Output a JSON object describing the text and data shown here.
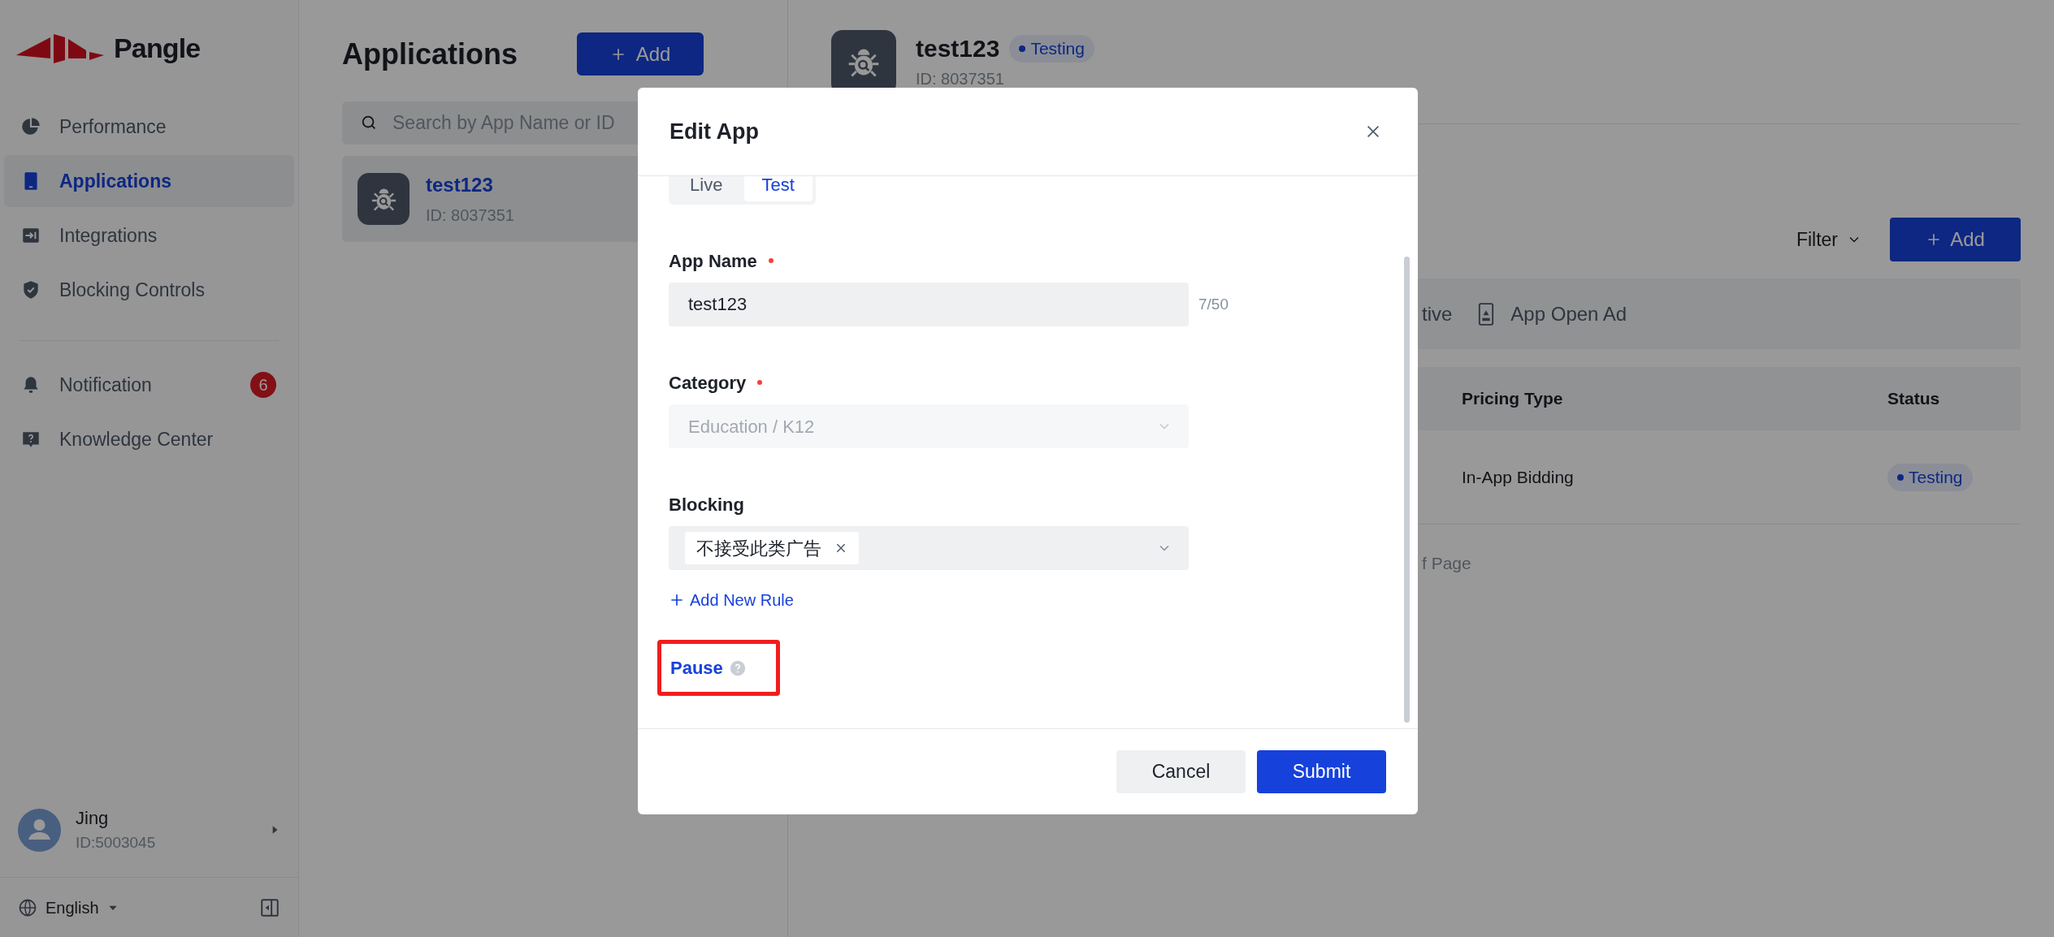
{
  "sidebar": {
    "logo": "Pangle",
    "items": [
      {
        "label": "Performance",
        "selected": false
      },
      {
        "label": "Applications",
        "selected": true
      },
      {
        "label": "Integrations",
        "selected": false
      },
      {
        "label": "Blocking Controls",
        "selected": false
      }
    ],
    "secondary_items": [
      {
        "label": "Notification",
        "badge": "6"
      },
      {
        "label": "Knowledge Center"
      }
    ],
    "user": {
      "name": "Jing",
      "id": "ID:5003045"
    },
    "language": "English"
  },
  "applications_panel": {
    "title": "Applications",
    "add_button": "Add",
    "search": {
      "placeholder": "Search by App Name or ID"
    },
    "apps": [
      {
        "name": "test123",
        "id": "ID: 8037351",
        "selected": true
      }
    ]
  },
  "app_detail": {
    "name": "test123",
    "status": "Testing",
    "id": "ID: 8037351",
    "filter": "Filter",
    "add_button": "Add",
    "ad_formats": [
      {
        "label": "tive",
        "kind": "text"
      },
      {
        "label": "App Open Ad",
        "kind": "app_open"
      }
    ],
    "table": {
      "columns": [
        "Pricing Type",
        "Status"
      ],
      "rows": [
        {
          "pricing_type": "In-App Bidding",
          "status": "Testing"
        }
      ]
    },
    "footer_fragment": "f Page"
  },
  "modal": {
    "title": "Edit App",
    "environment": [
      {
        "label": "Live",
        "selected": false
      },
      {
        "label": "Test",
        "selected": true
      }
    ],
    "fields": [
      {
        "kind": "text",
        "label": "App Name",
        "required": true,
        "disabled": false,
        "value": "test123",
        "counter": "7/50"
      },
      {
        "kind": "select",
        "label": "Category",
        "required": true,
        "disabled": true,
        "value": "Education / K12"
      },
      {
        "kind": "tags",
        "label": "Blocking",
        "required": false,
        "disabled": false,
        "tags": [
          "不接受此类广告"
        ]
      }
    ],
    "add_rule": "Add New Rule",
    "pause_label": "Pause",
    "buttons": [
      {
        "label": "Cancel",
        "kind": "secondary"
      },
      {
        "label": "Submit",
        "kind": "primary"
      }
    ]
  }
}
